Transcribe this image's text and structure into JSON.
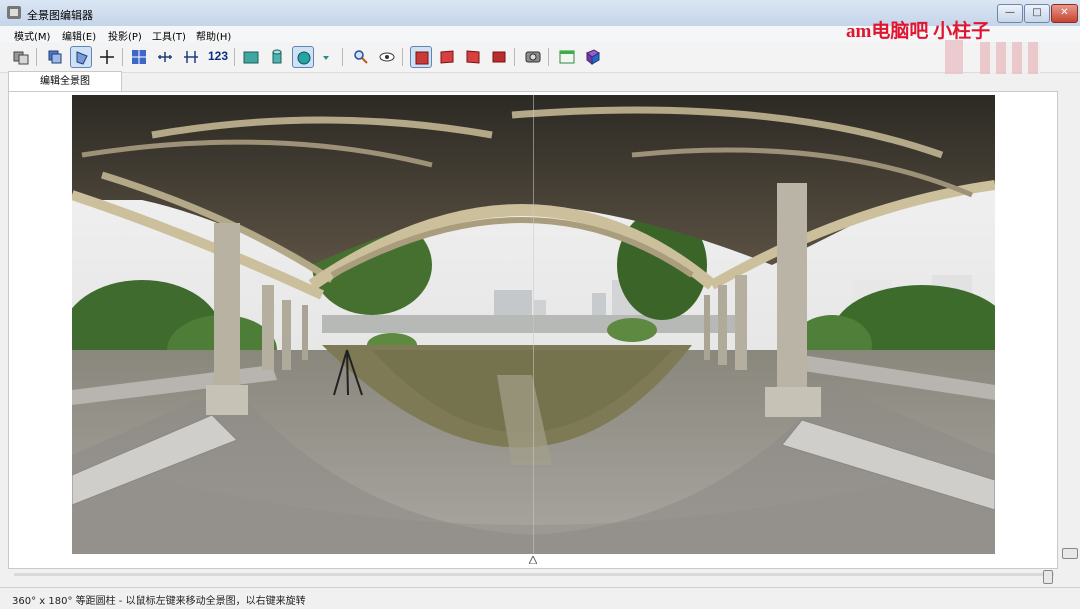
{
  "window": {
    "title": "全景图编辑器",
    "controls": [
      "—",
      "□",
      "✕"
    ]
  },
  "menu": [
    "模式(M)",
    "编辑(E)",
    "投影(P)",
    "工具(T)",
    "帮助(H)"
  ],
  "toolbar": {
    "icons": [
      "settings-icon",
      "layers-icon",
      "select-icon",
      "crosshair-icon",
      "grid-icon",
      "horizontal-icon",
      "vertical-icon",
      "numbering-icon",
      "image-icon",
      "cylinder-icon",
      "sphere-icon",
      "dropdown-arrow-icon",
      "zoom-icon",
      "view-icon",
      "frame-1-icon",
      "frame-2-icon",
      "frame-3-icon",
      "frame-4-icon",
      "capture-icon",
      "window-icon",
      "book-icon"
    ],
    "numbering_label": "123"
  },
  "tab": {
    "label": "编辑全景图"
  },
  "status": {
    "text": "360° x 180° 等距圆柱 - 以鼠标左键来移动全景图，以右键来旋转"
  },
  "watermark": {
    "text": "am电脑吧 小柱子"
  },
  "colors": {
    "watermark": "#e0152f",
    "active_tool": "#cfe1f5"
  }
}
